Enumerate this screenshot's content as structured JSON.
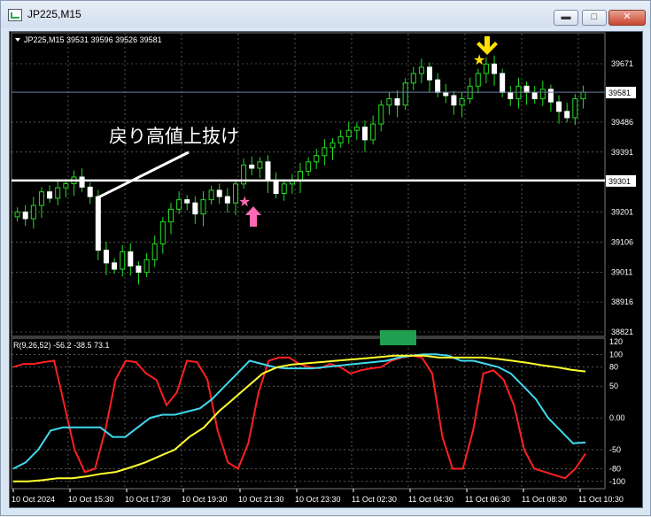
{
  "window": {
    "title": "JP225,M15",
    "minimize": "▬",
    "maximize": "□",
    "close": "✕"
  },
  "chart_data": [
    {
      "type": "candlestick",
      "header": "JP225,M15  39531 39596 39526 39581",
      "annotation": "戻り高値上抜け",
      "yticks": [
        "39671",
        "39581",
        "39486",
        "39391",
        "39301",
        "39201",
        "39106",
        "39011",
        "38916",
        "38821"
      ],
      "yrange": [
        38821,
        39706
      ],
      "current_price": "39581",
      "horizontal_line": "39301",
      "closes": [
        39201,
        39180,
        39222,
        39265,
        39245,
        39278,
        39291,
        39312,
        39280,
        39250,
        39080,
        39040,
        39020,
        39075,
        39030,
        39010,
        39050,
        39100,
        39170,
        39210,
        39240,
        39230,
        39195,
        39240,
        39270,
        39250,
        39230,
        39290,
        39350,
        39340,
        39360,
        39300,
        39260,
        39290,
        39300,
        39330,
        39360,
        39380,
        39405,
        39420,
        39440,
        39460,
        39470,
        39430,
        39480,
        39540,
        39560,
        39540,
        39610,
        39640,
        39660,
        39620,
        39580,
        39570,
        39540,
        39560,
        39600,
        39640,
        39670,
        39640,
        39580,
        39560,
        39600,
        39580,
        39560,
        39590,
        39550,
        39520,
        39500,
        39560,
        39581
      ]
    },
    {
      "type": "line",
      "header": "R(9,26,52) -56.2 -38.5 73.1",
      "yticks": [
        "120",
        "100",
        "80",
        "50",
        "0.00",
        "-50",
        "-80",
        "-100"
      ],
      "yrange": [
        -110,
        120
      ],
      "xticks": [
        "10 Oct 2024",
        "10 Oct 15:30",
        "10 Oct 17:30",
        "10 Oct 19:30",
        "10 Oct 21:30",
        "10 Oct 23:30",
        "11 Oct 02:30",
        "11 Oct 04:30",
        "11 Oct 06:30",
        "11 Oct 08:30",
        "11 Oct 10:30"
      ],
      "series": [
        {
          "color": "#ff2020",
          "values": [
            80,
            85,
            85,
            88,
            90,
            20,
            -50,
            -85,
            -80,
            -20,
            60,
            90,
            88,
            70,
            60,
            20,
            40,
            90,
            88,
            60,
            -20,
            -70,
            -80,
            -40,
            40,
            90,
            95,
            95,
            85,
            80,
            78,
            85,
            80,
            70,
            75,
            78,
            80,
            90,
            95,
            98,
            95,
            70,
            -30,
            -80,
            -80,
            -20,
            70,
            75,
            60,
            20,
            -50,
            -80,
            -85,
            -90,
            -95,
            -80,
            -56.2
          ]
        },
        {
          "color": "#40d8f0",
          "values": [
            -80,
            -70,
            -50,
            -20,
            -15,
            -15,
            -15,
            -15,
            -30,
            -30,
            -15,
            0,
            5,
            5,
            10,
            15,
            30,
            50,
            70,
            90,
            85,
            80,
            78,
            78,
            78,
            80,
            82,
            84,
            86,
            88,
            90,
            95,
            98,
            100,
            100,
            98,
            90,
            90,
            85,
            80,
            70,
            50,
            30,
            0,
            -20,
            -40,
            -38.5
          ]
        },
        {
          "color": "#ffff30",
          "values": [
            -100,
            -100,
            -98,
            -95,
            -95,
            -92,
            -88,
            -85,
            -78,
            -70,
            -60,
            -50,
            -30,
            -15,
            10,
            30,
            50,
            70,
            80,
            84,
            86,
            88,
            90,
            92,
            94,
            96,
            98,
            98,
            98,
            95,
            95,
            95,
            95,
            93,
            90,
            87,
            83,
            80,
            76,
            73.1
          ]
        }
      ]
    }
  ]
}
